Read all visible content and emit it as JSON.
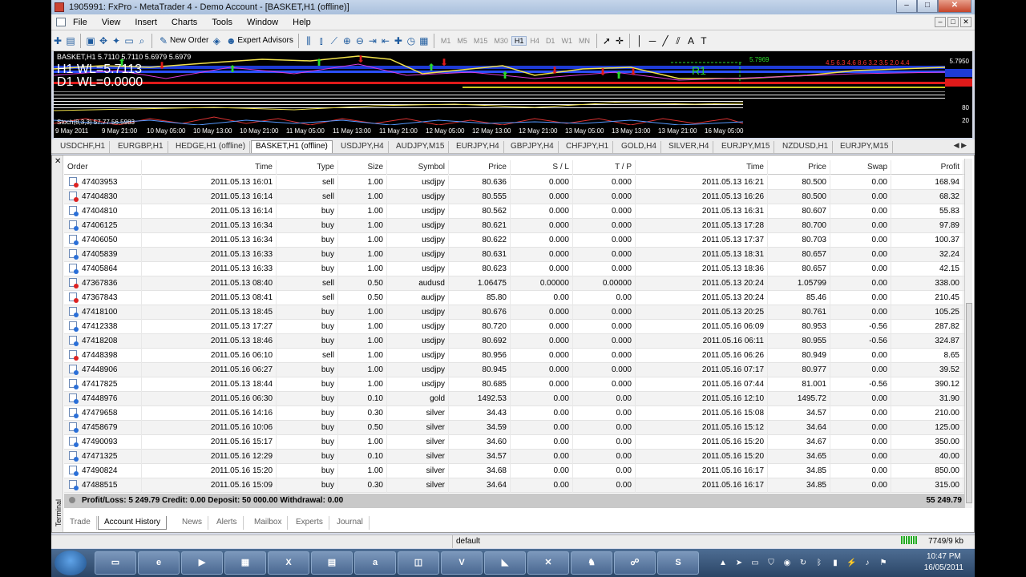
{
  "window": {
    "title": "1905991: FxPro - MetaTrader 4 - Demo Account - [BASKET,H1 (offline)]",
    "controls": [
      "–",
      "□",
      "✕"
    ]
  },
  "menu": [
    "File",
    "View",
    "Insert",
    "Charts",
    "Tools",
    "Window",
    "Help"
  ],
  "toolbar": {
    "new_order": "New Order",
    "expert_advisors": "Expert Advisors",
    "timeframes": [
      "M1",
      "M5",
      "M15",
      "M30",
      "H1",
      "H4",
      "D1",
      "W1",
      "MN"
    ],
    "active_timeframe": "H1"
  },
  "chart": {
    "header": "BASKET,H1  5.7110 5.7110 5.6979 5.6979",
    "big_line1": "H1 WL=5.7113",
    "big_line2": "D1 WL=0.0000",
    "price_top": "5.7950",
    "price_mid": "5.7969",
    "r1": "R1",
    "legend_nums": "4.5  6.3  4.6  8.6  3.2  3.5  2.0  4.4",
    "stoch": "Stoch(8,3,3) 57.77 56.5983",
    "stoch_levels": [
      "80",
      "20"
    ],
    "time_labels": [
      "9 May 2011",
      "9 May 21:00",
      "10 May 05:00",
      "10 May 13:00",
      "10 May 21:00",
      "11 May 05:00",
      "11 May 13:00",
      "11 May 21:00",
      "12 May 05:00",
      "12 May 13:00",
      "12 May 21:00",
      "13 May 05:00",
      "13 May 13:00",
      "13 May 21:00",
      "16 May 05:00"
    ]
  },
  "chart_tabs": [
    "USDCHF,H1",
    "EURGBP,H1",
    "HEDGE,H1 (offline)",
    "BASKET,H1 (offline)",
    "USDJPY,H4",
    "AUDJPY,M15",
    "EURJPY,H4",
    "GBPJPY,H4",
    "CHFJPY,H1",
    "GOLD,H4",
    "SILVER,H4",
    "EURJPY,M15",
    "NZDUSD,H1",
    "EURJPY,M15"
  ],
  "active_chart_tab": "BASKET,H1 (offline)",
  "history": {
    "columns": [
      "Order",
      "Time",
      "Type",
      "Size",
      "Symbol",
      "Price",
      "S / L",
      "T / P",
      "Time",
      "Price",
      "Swap",
      "Profit"
    ],
    "rows": [
      [
        "47403953",
        "2011.05.13 16:01",
        "sell",
        "1.00",
        "usdjpy",
        "80.636",
        "0.000",
        "0.000",
        "2011.05.13 16:21",
        "80.500",
        "0.00",
        "168.94"
      ],
      [
        "47404830",
        "2011.05.13 16:14",
        "sell",
        "1.00",
        "usdjpy",
        "80.555",
        "0.000",
        "0.000",
        "2011.05.13 16:26",
        "80.500",
        "0.00",
        "68.32"
      ],
      [
        "47404810",
        "2011.05.13 16:14",
        "buy",
        "1.00",
        "usdjpy",
        "80.562",
        "0.000",
        "0.000",
        "2011.05.13 16:31",
        "80.607",
        "0.00",
        "55.83"
      ],
      [
        "47406125",
        "2011.05.13 16:34",
        "buy",
        "1.00",
        "usdjpy",
        "80.621",
        "0.000",
        "0.000",
        "2011.05.13 17:28",
        "80.700",
        "0.00",
        "97.89"
      ],
      [
        "47406050",
        "2011.05.13 16:34",
        "buy",
        "1.00",
        "usdjpy",
        "80.622",
        "0.000",
        "0.000",
        "2011.05.13 17:37",
        "80.703",
        "0.00",
        "100.37"
      ],
      [
        "47405839",
        "2011.05.13 16:33",
        "buy",
        "1.00",
        "usdjpy",
        "80.631",
        "0.000",
        "0.000",
        "2011.05.13 18:31",
        "80.657",
        "0.00",
        "32.24"
      ],
      [
        "47405864",
        "2011.05.13 16:33",
        "buy",
        "1.00",
        "usdjpy",
        "80.623",
        "0.000",
        "0.000",
        "2011.05.13 18:36",
        "80.657",
        "0.00",
        "42.15"
      ],
      [
        "47367836",
        "2011.05.13 08:40",
        "sell",
        "0.50",
        "audusd",
        "1.06475",
        "0.00000",
        "0.00000",
        "2011.05.13 20:24",
        "1.05799",
        "0.00",
        "338.00"
      ],
      [
        "47367843",
        "2011.05.13 08:41",
        "sell",
        "0.50",
        "audjpy",
        "85.80",
        "0.00",
        "0.00",
        "2011.05.13 20:24",
        "85.46",
        "0.00",
        "210.45"
      ],
      [
        "47418100",
        "2011.05.13 18:45",
        "buy",
        "1.00",
        "usdjpy",
        "80.676",
        "0.000",
        "0.000",
        "2011.05.13 20:25",
        "80.761",
        "0.00",
        "105.25"
      ],
      [
        "47412338",
        "2011.05.13 17:27",
        "buy",
        "1.00",
        "usdjpy",
        "80.720",
        "0.000",
        "0.000",
        "2011.05.16 06:09",
        "80.953",
        "-0.56",
        "287.82"
      ],
      [
        "47418208",
        "2011.05.13 18:46",
        "buy",
        "1.00",
        "usdjpy",
        "80.692",
        "0.000",
        "0.000",
        "2011.05.16 06:11",
        "80.955",
        "-0.56",
        "324.87"
      ],
      [
        "47448398",
        "2011.05.16 06:10",
        "sell",
        "1.00",
        "usdjpy",
        "80.956",
        "0.000",
        "0.000",
        "2011.05.16 06:26",
        "80.949",
        "0.00",
        "8.65"
      ],
      [
        "47448906",
        "2011.05.16 06:27",
        "buy",
        "1.00",
        "usdjpy",
        "80.945",
        "0.000",
        "0.000",
        "2011.05.16 07:17",
        "80.977",
        "0.00",
        "39.52"
      ],
      [
        "47417825",
        "2011.05.13 18:44",
        "buy",
        "1.00",
        "usdjpy",
        "80.685",
        "0.000",
        "0.000",
        "2011.05.16 07:44",
        "81.001",
        "-0.56",
        "390.12"
      ],
      [
        "47448976",
        "2011.05.16 06:30",
        "buy",
        "0.10",
        "gold",
        "1492.53",
        "0.00",
        "0.00",
        "2011.05.16 12:10",
        "1495.72",
        "0.00",
        "31.90"
      ],
      [
        "47479658",
        "2011.05.16 14:16",
        "buy",
        "0.30",
        "silver",
        "34.43",
        "0.00",
        "0.00",
        "2011.05.16 15:08",
        "34.57",
        "0.00",
        "210.00"
      ],
      [
        "47458679",
        "2011.05.16 10:06",
        "buy",
        "0.50",
        "silver",
        "34.59",
        "0.00",
        "0.00",
        "2011.05.16 15:12",
        "34.64",
        "0.00",
        "125.00"
      ],
      [
        "47490093",
        "2011.05.16 15:17",
        "buy",
        "1.00",
        "silver",
        "34.60",
        "0.00",
        "0.00",
        "2011.05.16 15:20",
        "34.67",
        "0.00",
        "350.00"
      ],
      [
        "47471325",
        "2011.05.16 12:29",
        "buy",
        "0.10",
        "silver",
        "34.57",
        "0.00",
        "0.00",
        "2011.05.16 15:20",
        "34.65",
        "0.00",
        "40.00"
      ],
      [
        "47490824",
        "2011.05.16 15:20",
        "buy",
        "1.00",
        "silver",
        "34.68",
        "0.00",
        "0.00",
        "2011.05.16 16:17",
        "34.85",
        "0.00",
        "850.00"
      ],
      [
        "47488515",
        "2011.05.16 15:09",
        "buy",
        "0.30",
        "silver",
        "34.64",
        "0.00",
        "0.00",
        "2011.05.16 16:17",
        "34.85",
        "0.00",
        "315.00"
      ]
    ],
    "totals_label": "Profit/Loss: 5 249.79  Credit: 0.00  Deposit: 50 000.00  Withdrawal: 0.00",
    "totals_profit": "55 249.79"
  },
  "terminal_label": "Terminal",
  "bottom_tabs": [
    "Trade",
    "Account History",
    "News",
    "Alerts",
    "Mailbox",
    "Experts",
    "Journal"
  ],
  "active_bottom_tab": "Account History",
  "status": {
    "profile": "default",
    "traffic": "7749/9 kb"
  },
  "taskbar": {
    "time": "10:47 PM",
    "date": "16/05/2011",
    "apps": [
      "explorer",
      "ie",
      "media",
      "calculator",
      "excel",
      "folder",
      "alpari",
      "terminal",
      "vmware",
      "flag",
      "x",
      "game",
      "network",
      "skype"
    ]
  },
  "colors": {
    "sell_marker": "#d22222",
    "buy_marker": "#2a6fd8",
    "chart_bg": "#000000",
    "accent": "#2ad92a"
  }
}
